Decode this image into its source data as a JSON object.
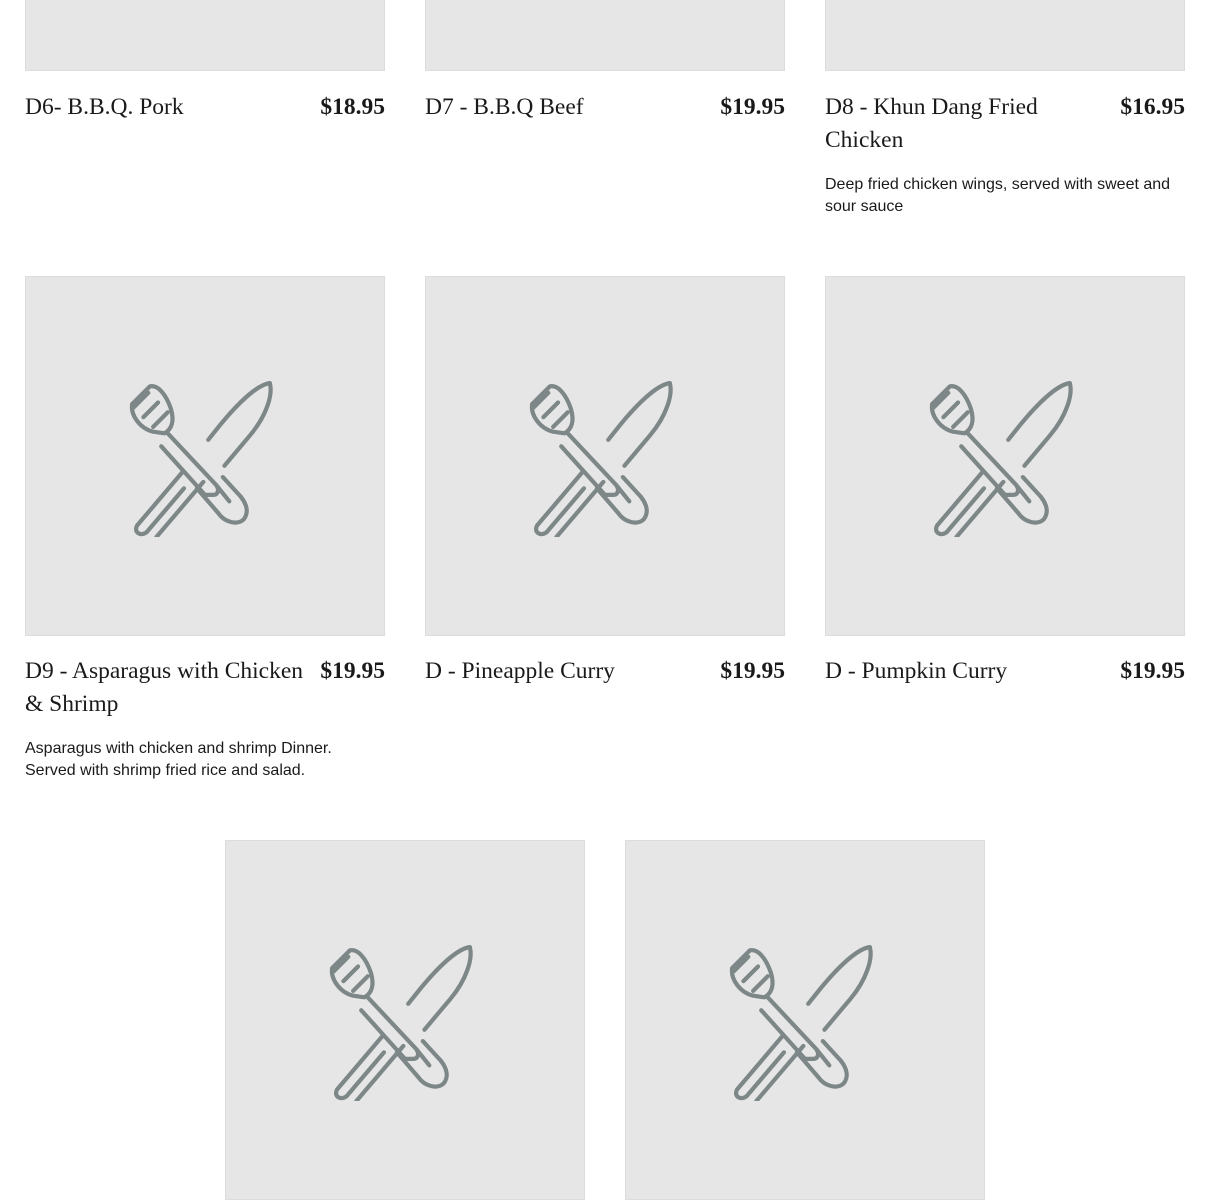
{
  "icons": {
    "placeholder": "fork-knife-icon",
    "stroke_color": "#7d8787",
    "tile_color": "#e6e6e6"
  },
  "items": [
    {
      "name": "D6- B.B.Q. Pork",
      "price": "$18.95",
      "description": ""
    },
    {
      "name": "D7 - B.B.Q Beef",
      "price": "$19.95",
      "description": ""
    },
    {
      "name": "D8 - Khun Dang Fried Chicken",
      "price": "$16.95",
      "description": "Deep fried chicken wings, served with sweet and sour sauce"
    },
    {
      "name": "D9 - Asparagus with Chicken & Shrimp",
      "price": "$19.95",
      "description": "Asparagus with chicken and shrimp Dinner. Served with shrimp fried rice and salad."
    },
    {
      "name": "D - Pineapple Curry",
      "price": "$19.95",
      "description": ""
    },
    {
      "name": "D - Pumpkin Curry",
      "price": "$19.95",
      "description": ""
    }
  ]
}
